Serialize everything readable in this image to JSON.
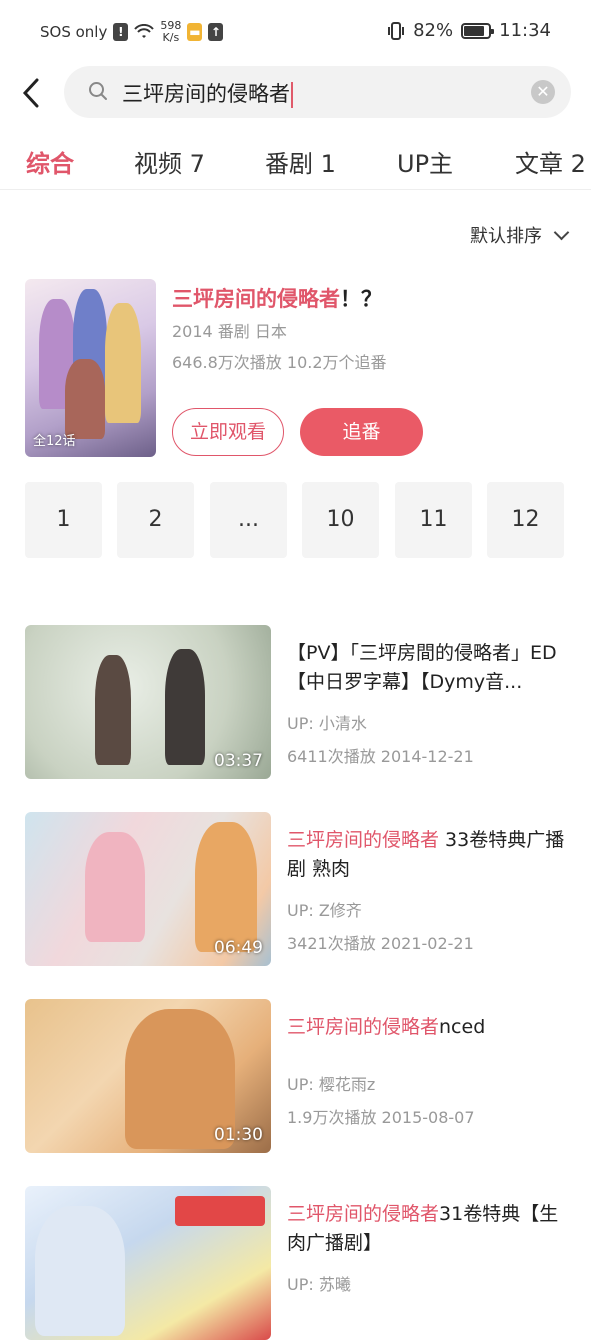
{
  "status_bar": {
    "carrier": "SOS only",
    "speed_value": "598",
    "speed_unit": "K/s",
    "battery": "82%",
    "battery_level": 0.82,
    "time": "11:34"
  },
  "search": {
    "query": "三坪房间的侵略者"
  },
  "tabs": [
    {
      "label": "综合"
    },
    {
      "label": "视频  7"
    },
    {
      "label": "番剧  1"
    },
    {
      "label": "UP主"
    },
    {
      "label": "文章  2"
    }
  ],
  "sort": {
    "label": "默认排序"
  },
  "bangumi": {
    "title_highlight": "三坪房间的侵略者",
    "title_rest": "！？",
    "meta": "2014  番剧  日本",
    "stats": "646.8万次播放  10.2万个追番",
    "episode_badge": "全12话",
    "watch_label": "立即观看",
    "follow_label": "追番",
    "episodes": [
      "1",
      "2",
      "...",
      "10",
      "11",
      "12"
    ]
  },
  "videos": [
    {
      "title_highlight": "",
      "title_rest": "【PV】「三坪房間的侵略者」ED【中日罗字幕】【Dymy音...",
      "up": "UP: 小清水",
      "stats": "6411次播放  2014-12-21",
      "duration": "03:37"
    },
    {
      "title_highlight": "三坪房间的侵略者",
      "title_rest": " 33卷特典广播剧 熟肉",
      "up": "UP: Z修齐",
      "stats": "3421次播放  2021-02-21",
      "duration": "06:49"
    },
    {
      "title_highlight": "三坪房间的侵略者",
      "title_rest": "nced",
      "up": "UP: 樱花雨z",
      "stats": "1.9万次播放  2015-08-07",
      "duration": "01:30"
    },
    {
      "title_highlight": "三坪房间的侵略者",
      "title_rest": "31卷特典【生肉广播剧】",
      "up": "UP: 苏曦",
      "stats": "",
      "duration": ""
    }
  ]
}
